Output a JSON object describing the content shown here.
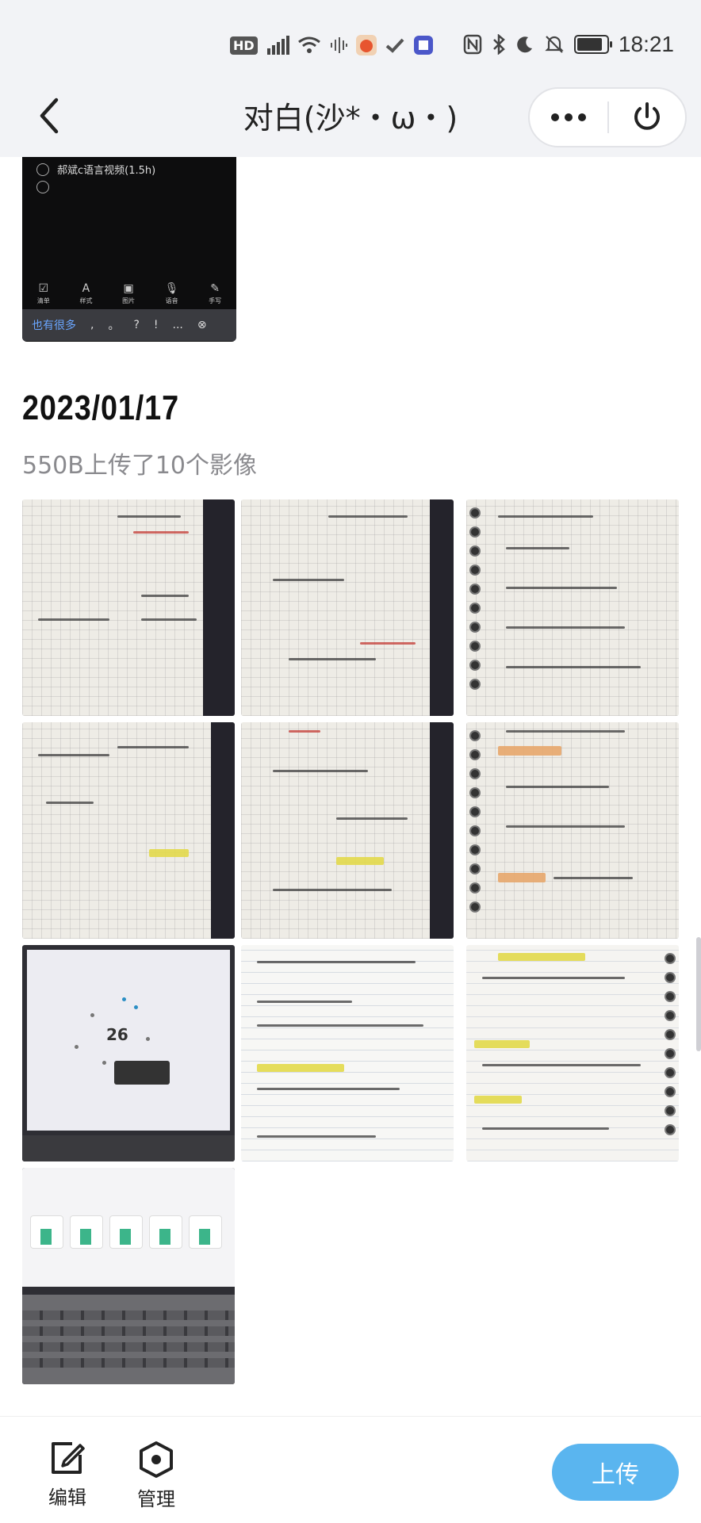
{
  "status_bar": {
    "left_icons": [
      "hd-icon",
      "signal-5g-icon",
      "signal-6-icon",
      "wifi-icon",
      "voice-wave-icon",
      "tomato-app-icon",
      "check-app-icon",
      "sticker-app-icon"
    ],
    "right_icons": [
      "nfc-icon",
      "bluetooth-icon",
      "moon-icon",
      "mute-icon",
      "battery-icon"
    ],
    "hd_label": "HD",
    "time": "18:21",
    "battery_level": 0.85
  },
  "header": {
    "title": "对白(沙*・ω・)",
    "back_icon": "chevron-left-icon",
    "more_icon": "more-horizontal-icon",
    "power_icon": "power-icon"
  },
  "prev_item": {
    "todo_items": [
      "郝斌c语言视频(1.5h)",
      ""
    ],
    "keyboard_tools": [
      {
        "glyph": "☑",
        "label": "清单"
      },
      {
        "glyph": "A",
        "label": "样式"
      },
      {
        "glyph": "▣",
        "label": "图片"
      },
      {
        "glyph": "🎙",
        "label": "语音"
      },
      {
        "glyph": "✎",
        "label": "手写"
      }
    ],
    "keyboard_suggestion": "也有很多",
    "keyboard_punct": [
      ",",
      "。",
      "?",
      "!",
      "..."
    ],
    "keyboard_close": "⊗"
  },
  "group": {
    "date": "2023/01/17",
    "subtitle": "550B上传了10个影像",
    "photos": [
      {
        "kind": "notebook-spread"
      },
      {
        "kind": "notebook-spread"
      },
      {
        "kind": "notebook-page-rings"
      },
      {
        "kind": "notebook-spread"
      },
      {
        "kind": "notebook-spread"
      },
      {
        "kind": "notebook-page-rings-highlight"
      },
      {
        "kind": "laptop-screen-dots",
        "center_text": "26"
      },
      {
        "kind": "lined-notes"
      },
      {
        "kind": "notebook-page-rings-highlight"
      },
      {
        "kind": "laptop-dashboard"
      }
    ]
  },
  "bottom_bar": {
    "edit_label": "编辑",
    "manage_label": "管理",
    "upload_label": "上传",
    "edit_icon": "edit-icon",
    "manage_icon": "hexagon-settings-icon"
  },
  "colors": {
    "accent": "#5ab5ef",
    "header_bg": "#f2f3f6",
    "subtitle": "#8a8a8e"
  }
}
